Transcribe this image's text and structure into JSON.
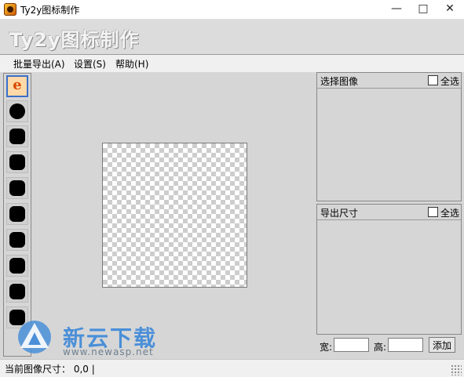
{
  "window": {
    "title": "Ty2y图标制作",
    "icon": "app-icon"
  },
  "banner": {
    "title": "Ty2y图标制作"
  },
  "menu": [
    "批量导出(A)",
    "设置(S)",
    "帮助(H)"
  ],
  "thumbnails": [
    {
      "icon": "ie-icon",
      "label": "e",
      "selected": true
    },
    {
      "icon": "black-circle-icon"
    },
    {
      "icon": "black-square-icon"
    },
    {
      "icon": "black-square-icon"
    },
    {
      "icon": "black-square-icon"
    },
    {
      "icon": "black-square-icon"
    },
    {
      "icon": "black-square-icon"
    },
    {
      "icon": "black-square-icon"
    },
    {
      "icon": "black-square-icon"
    },
    {
      "icon": "black-square-icon"
    }
  ],
  "select_panel": {
    "title": "选择图像",
    "select_all": "全选"
  },
  "export_panel": {
    "title": "导出尺寸",
    "select_all": "全选"
  },
  "size_controls": {
    "width_label": "宽:",
    "height_label": "高:",
    "width_value": "",
    "height_value": "",
    "add_label": "添加"
  },
  "status": {
    "text": "当前图像尺寸： 0,0 |"
  },
  "watermark": {
    "brand": "新云下载",
    "url": "www.newasp.net"
  }
}
